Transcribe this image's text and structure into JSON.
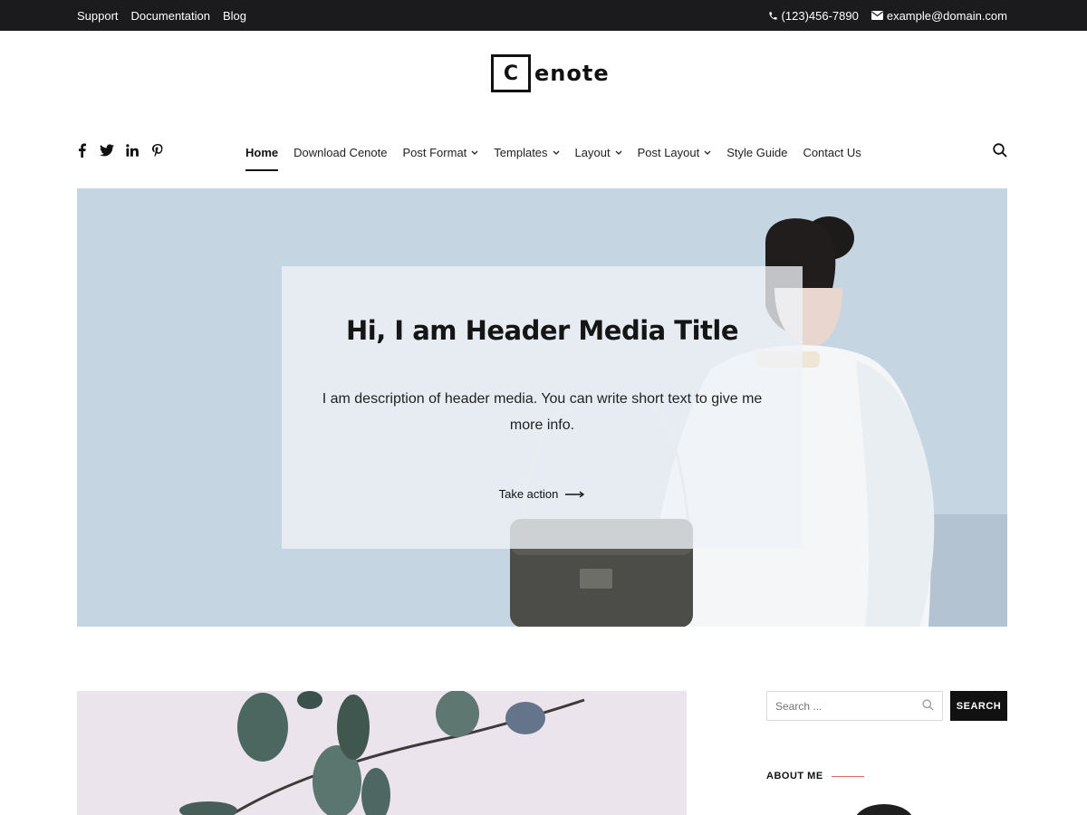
{
  "topbar": {
    "links": [
      "Support",
      "Documentation",
      "Blog"
    ],
    "phone": "(123)456-7890",
    "email": "example@domain.com",
    "phone_icon": "phone-icon",
    "email_icon": "envelope-icon"
  },
  "logo": {
    "initial": "C",
    "rest": "enote"
  },
  "social": [
    "facebook-icon",
    "twitter-icon",
    "linkedin-icon",
    "pinterest-icon"
  ],
  "nav": {
    "items": [
      {
        "label": "Home",
        "active": true,
        "dropdown": false
      },
      {
        "label": "Download Cenote",
        "active": false,
        "dropdown": false
      },
      {
        "label": "Post Format",
        "active": false,
        "dropdown": true
      },
      {
        "label": "Templates",
        "active": false,
        "dropdown": true
      },
      {
        "label": "Layout",
        "active": false,
        "dropdown": true
      },
      {
        "label": "Post Layout",
        "active": false,
        "dropdown": true
      },
      {
        "label": "Style Guide",
        "active": false,
        "dropdown": false
      },
      {
        "label": "Contact Us",
        "active": false,
        "dropdown": false
      }
    ],
    "search_icon": "search-icon"
  },
  "hero": {
    "title": "Hi, I am Header Media Title",
    "description": "I am description of header media. You can write short text to give me more info.",
    "cta": "Take action",
    "cta_icon": "arrow-right-icon"
  },
  "sidebar": {
    "search": {
      "placeholder": "Search ...",
      "button": "SEARCH"
    },
    "about_heading": "ABOUT ME"
  },
  "colors": {
    "topbar_bg": "#1b1b1d",
    "accent_line": "#e06a6f",
    "button_bg": "#111111"
  }
}
